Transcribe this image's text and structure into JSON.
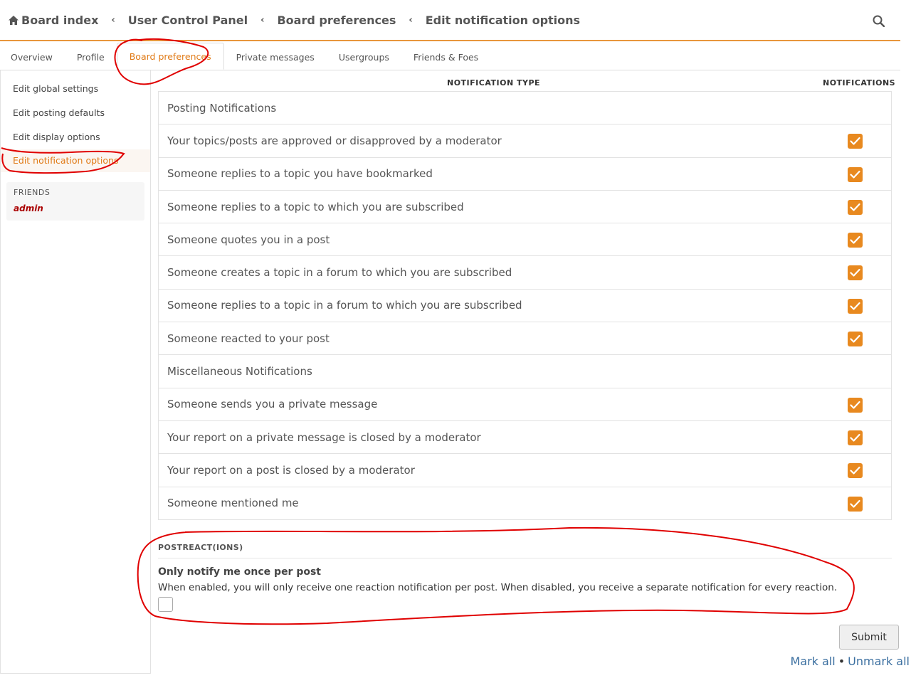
{
  "breadcrumb": {
    "items": [
      "Board index",
      "User Control Panel",
      "Board preferences",
      "Edit notification options"
    ],
    "separator": "‹"
  },
  "tabs": [
    "Overview",
    "Profile",
    "Board preferences",
    "Private messages",
    "Usergroups",
    "Friends & Foes"
  ],
  "active_tab": "Board preferences",
  "sidebar": {
    "items": [
      "Edit global settings",
      "Edit posting defaults",
      "Edit display options",
      "Edit notification options"
    ],
    "active_item": "Edit notification options",
    "friends_title": "FRIENDS",
    "friends": [
      "admin"
    ]
  },
  "table": {
    "col_type": "NOTIFICATION TYPE",
    "col_notify": "NOTIFICATIONS",
    "rows": [
      {
        "label": "Posting Notifications",
        "group": true
      },
      {
        "label": "Your topics/posts are approved or disapproved by a moderator",
        "checked": true
      },
      {
        "label": "Someone replies to a topic you have bookmarked",
        "checked": true
      },
      {
        "label": "Someone replies to a topic to which you are subscribed",
        "checked": true
      },
      {
        "label": "Someone quotes you in a post",
        "checked": true
      },
      {
        "label": "Someone creates a topic in a forum to which you are subscribed",
        "checked": true
      },
      {
        "label": "Someone replies to a topic in a forum to which you are subscribed",
        "checked": true
      },
      {
        "label": "Someone reacted to your post",
        "checked": true
      },
      {
        "label": "Miscellaneous Notifications",
        "group": true
      },
      {
        "label": "Someone sends you a private message",
        "checked": true
      },
      {
        "label": "Your report on a private message is closed by a moderator",
        "checked": true
      },
      {
        "label": "Your report on a post is closed by a moderator",
        "checked": true
      },
      {
        "label": "Someone mentioned me",
        "checked": true
      }
    ]
  },
  "postreactions": {
    "title": "POSTREACT(IONS)",
    "label": "Only notify me once per post",
    "description": "When enabled, you will only receive one reaction notification per post. When disabled, you receive a separate notification for every reaction.",
    "checked": false
  },
  "actions": {
    "submit": "Submit",
    "mark_all": "Mark all",
    "unmark_all": "Unmark all",
    "mark_sep": "•"
  },
  "colors": {
    "accent": "#e8891f",
    "annotation": "#e00000",
    "link": "#3b6fa0",
    "friend": "#aa0000"
  }
}
